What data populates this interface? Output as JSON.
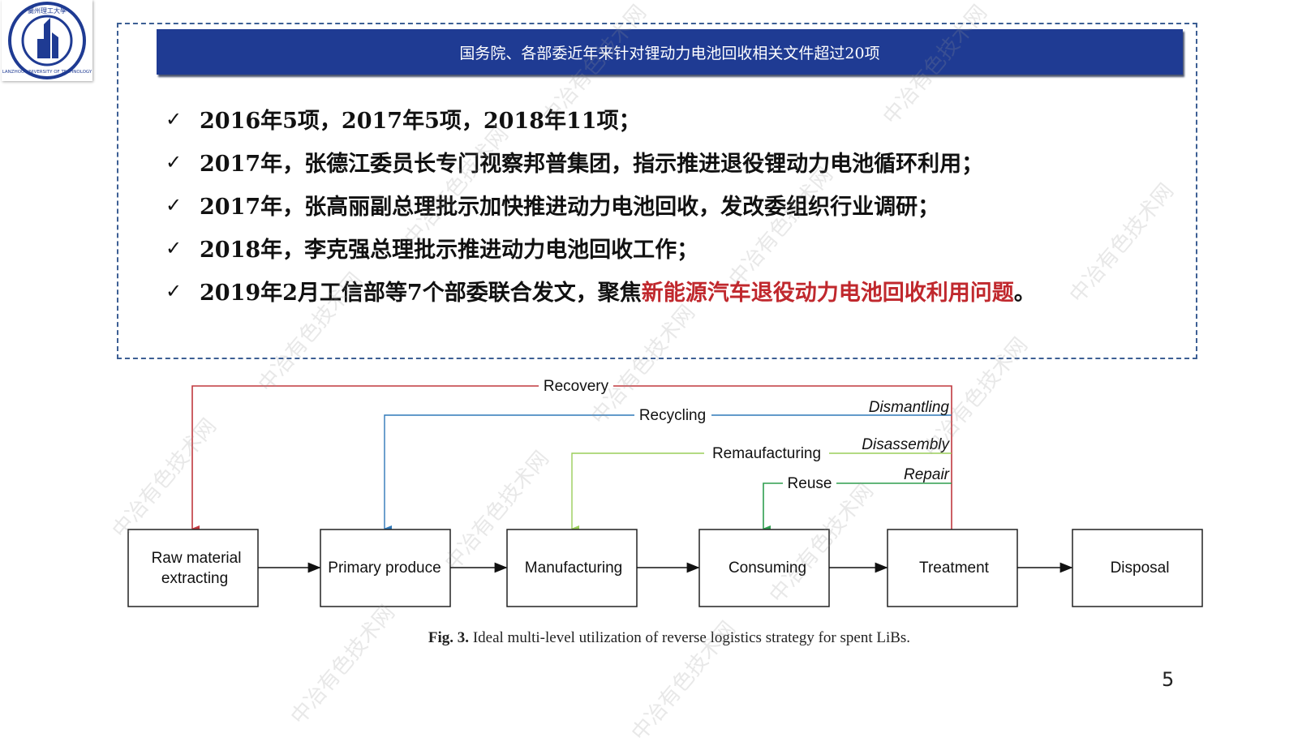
{
  "logo": {
    "name": "Lanzhou University of Technology",
    "text_cn": "蘭州理工大學",
    "text_en": "LANZHOU UNIVERSITY OF TECHNOLOGY"
  },
  "banner": {
    "title": "国务院、各部委近年来针对锂动力电池回收相关文件超过20项"
  },
  "bullets": [
    {
      "check": "✓",
      "text": "2016年5项，2017年5项，2018年11项；",
      "highlight": ""
    },
    {
      "check": "✓",
      "text": "2017年，张德江委员长专门视察邦普集团，指示推进退役锂动力电池循环利用；",
      "highlight": ""
    },
    {
      "check": "✓",
      "text": "2017年，张高丽副总理批示加快推进动力电池回收，发改委组织行业调研；",
      "highlight": ""
    },
    {
      "check": "✓",
      "text": "2018年，李克强总理批示推进动力电池回收工作；",
      "highlight": ""
    },
    {
      "check": "✓",
      "text": "2019年2月工信部等7个部委联合发文，聚焦",
      "highlight": "新能源汽车退役动力电池回收利用问题",
      "suffix": "。"
    }
  ],
  "colors": {
    "banner": "#1f3b93",
    "highlight": "#c0282d",
    "recovery": "#c0393f",
    "recycling": "#2f78b8",
    "remanufacturing": "#9acd5a",
    "reuse": "#2e9e4f"
  },
  "diagram": {
    "boxes": [
      {
        "line1": "Raw material",
        "line2": "extracting"
      },
      {
        "line1": "Primary produce",
        "line2": ""
      },
      {
        "line1": "Manufacturing",
        "line2": ""
      },
      {
        "line1": "Consuming",
        "line2": ""
      },
      {
        "line1": "Treatment",
        "line2": ""
      },
      {
        "line1": "Disposal",
        "line2": ""
      }
    ],
    "loops": [
      {
        "label": "Recovery",
        "side_label": ""
      },
      {
        "label": "Recycling",
        "side_label": "Dismantling"
      },
      {
        "label": "Remaufacturing",
        "side_label": "Disassembly"
      },
      {
        "label": "Reuse",
        "side_label": "Repair"
      }
    ]
  },
  "caption": {
    "fig": "Fig. 3.",
    "text": " Ideal multi-level utilization of reverse logistics strategy for spent LiBs."
  },
  "page_number": "5",
  "watermark": "中冶有色技术网"
}
